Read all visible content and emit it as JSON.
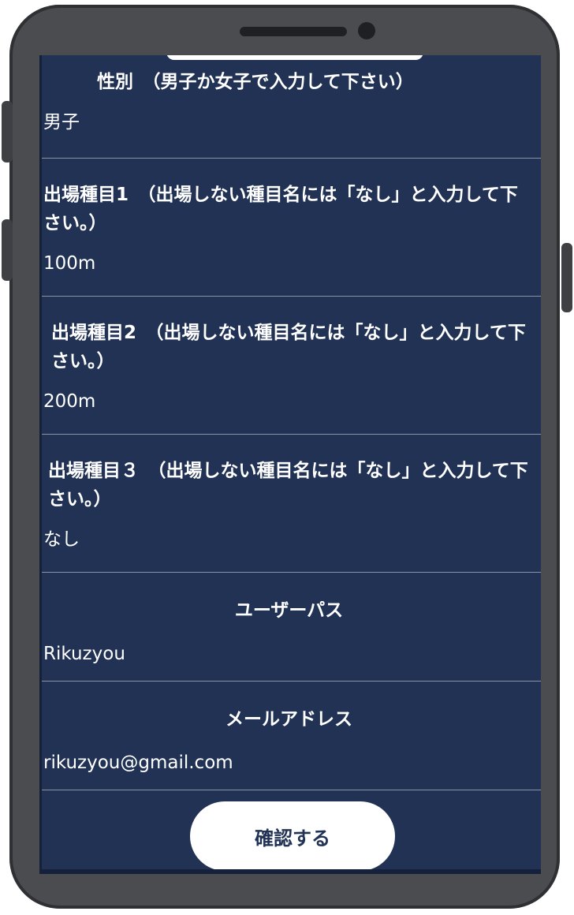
{
  "form": {
    "gender": {
      "label": "性別　（男子か女子で入力して下さい）",
      "value": "男子"
    },
    "event1": {
      "label": "出場種目1　（出場しない種目名には「なし」と入力して下さい。）",
      "value": "100m"
    },
    "event2": {
      "label": "出場種目2　（出場しない種目名には「なし」と入力して下さい。）",
      "value": "200m"
    },
    "event3": {
      "label": "出場種目３　（出場しない種目名には「なし」と入力して下さい。）",
      "value": "なし"
    },
    "user_pass": {
      "label": "ユーザーパス",
      "value": "Rikuzyou"
    },
    "email": {
      "label": "メールアドレス",
      "value": "rikuzyou@gmail.com"
    }
  },
  "actions": {
    "confirm_label": "確認する"
  },
  "colors": {
    "screen_bg": "#213254",
    "phone_frame": "#4a4c50",
    "button_bg": "#ffffff"
  }
}
